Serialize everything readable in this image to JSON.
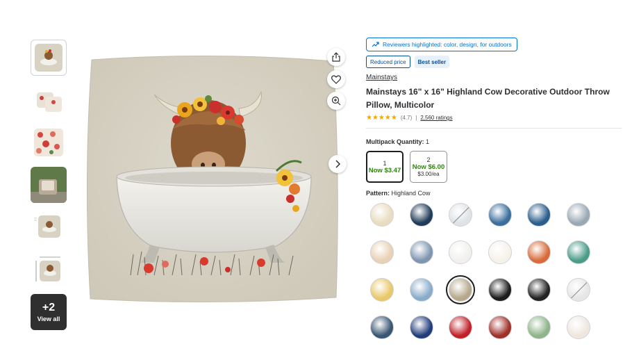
{
  "gallery": {
    "thumbnail_icons": [
      "cow-pillow",
      "pillow-pair",
      "floral-pillow",
      "patio-chair",
      "cow-pillow-sizes",
      "cow-pillow-dims"
    ],
    "more": {
      "count": "+2",
      "label": "View all"
    }
  },
  "main_image": {
    "alt_icon": "highland-cow-in-bathtub"
  },
  "actions": [
    "share-icon",
    "heart-icon",
    "zoom-icon",
    "chevron-right-icon"
  ],
  "highlights": {
    "text": "Reviewers highlighted: color, design, for outdoors"
  },
  "badges": {
    "reduced": "Reduced price",
    "best": "Best seller"
  },
  "product": {
    "brand": "Mainstays",
    "title": "Mainstays 16\" x 16\" Highland Cow Decorative Outdoor Throw Pillow, Multicolor",
    "rating_value": "(4.7)",
    "rating_sep": "|",
    "rating_count": "2,560 ratings",
    "stars": "★★★★★"
  },
  "multipack": {
    "label": "Multipack Quantity:",
    "selected_value": "1",
    "options": [
      {
        "qty": "1",
        "price": "Now $3.47",
        "per": ""
      },
      {
        "qty": "2",
        "price": "Now $6.00",
        "per": "$3.00/ea"
      }
    ]
  },
  "pattern": {
    "label": "Pattern:",
    "selected_value": "Highland Cow",
    "colors": {
      "swatches": [
        "#e9dcc0",
        "#1f3b57",
        "#dde3e6",
        "#3b6e9c",
        "#2a5e8c",
        "#9aa8b4",
        "#e8d1b5",
        "#7f96b0",
        "#f1f0ec",
        "#f6f2ea",
        "#d86b3a",
        "#4c9c8a",
        "#e8c86a",
        "#8aaccb",
        "#b7a88c",
        "#1d1d1d",
        "#222222",
        "#e6e6e6",
        "#3a5672",
        "#223e7a",
        "#c1222a",
        "#a0302a",
        "#8fb48a",
        "#efe7df"
      ]
    }
  }
}
